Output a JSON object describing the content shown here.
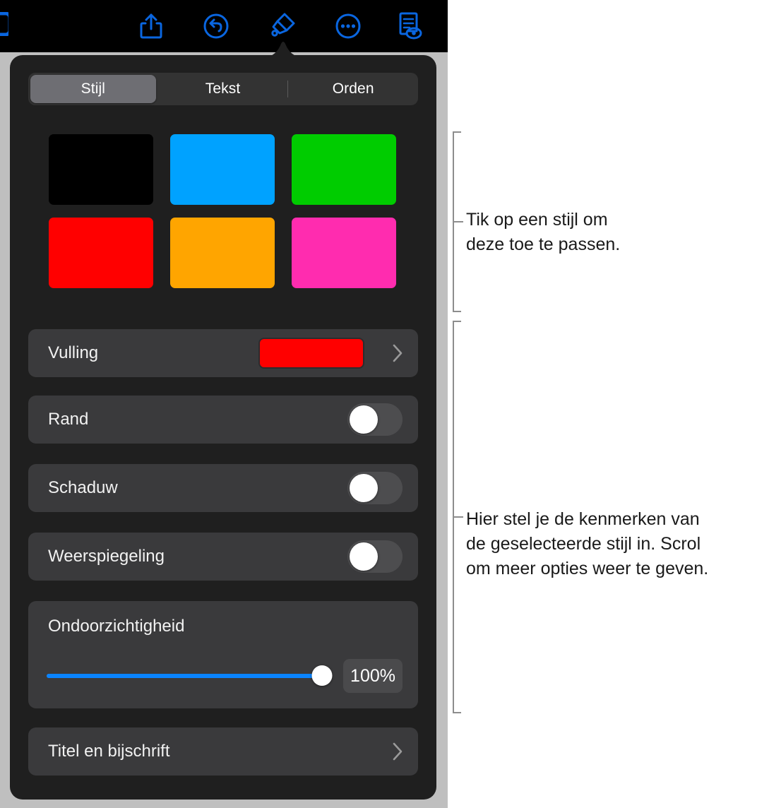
{
  "toolbar": {
    "icons": [
      {
        "name": "document-partial-icon",
        "label": "Document"
      },
      {
        "name": "share-icon",
        "label": "Deel"
      },
      {
        "name": "undo-icon",
        "label": "Herstel"
      },
      {
        "name": "paintbrush-icon",
        "label": "Opmaak"
      },
      {
        "name": "ellipsis-icon",
        "label": "Meer"
      },
      {
        "name": "document-view-icon",
        "label": "Weergave"
      }
    ],
    "accent_color": "#0A66E0",
    "background_color": "#000000"
  },
  "popover": {
    "background_color": "#1F1F1F",
    "segmented": {
      "items": [
        {
          "label": "Stijl",
          "selected": true
        },
        {
          "label": "Tekst",
          "selected": false
        },
        {
          "label": "Orden",
          "selected": false
        }
      ],
      "active_background": "#6E6E73"
    },
    "style_swatches": [
      {
        "name": "style-swatch-black",
        "color": "#000000"
      },
      {
        "name": "style-swatch-blue",
        "color": "#00A2FF"
      },
      {
        "name": "style-swatch-green",
        "color": "#00CC00"
      },
      {
        "name": "style-swatch-red",
        "color": "#FF0000"
      },
      {
        "name": "style-swatch-orange",
        "color": "#FFA500"
      },
      {
        "name": "style-swatch-magenta",
        "color": "#FF2CAF"
      }
    ],
    "rows": {
      "fill": {
        "label": "Vulling",
        "swatch_color": "#FF0000",
        "chevron": "chevron-right-icon"
      },
      "border": {
        "label": "Rand",
        "toggle_on": false
      },
      "shadow": {
        "label": "Schaduw",
        "toggle_on": false
      },
      "reflection": {
        "label": "Weerspiegeling",
        "toggle_on": false
      },
      "opacity": {
        "label": "Ondoorzichtigheid",
        "value": "100%",
        "percent": 100,
        "slider_color": "#0A84FF"
      },
      "title": {
        "label": "Titel en bijschrift",
        "chevron": "chevron-right-icon"
      }
    }
  },
  "annotations": [
    {
      "name": "callout-styles",
      "text": "Tik op een stijl om\ndeze toe te passen."
    },
    {
      "name": "callout-properties",
      "text": "Hier stel je de kenmerken van\nde geselecteerde stijl in. Scrol\nom meer opties weer te geven."
    }
  ]
}
